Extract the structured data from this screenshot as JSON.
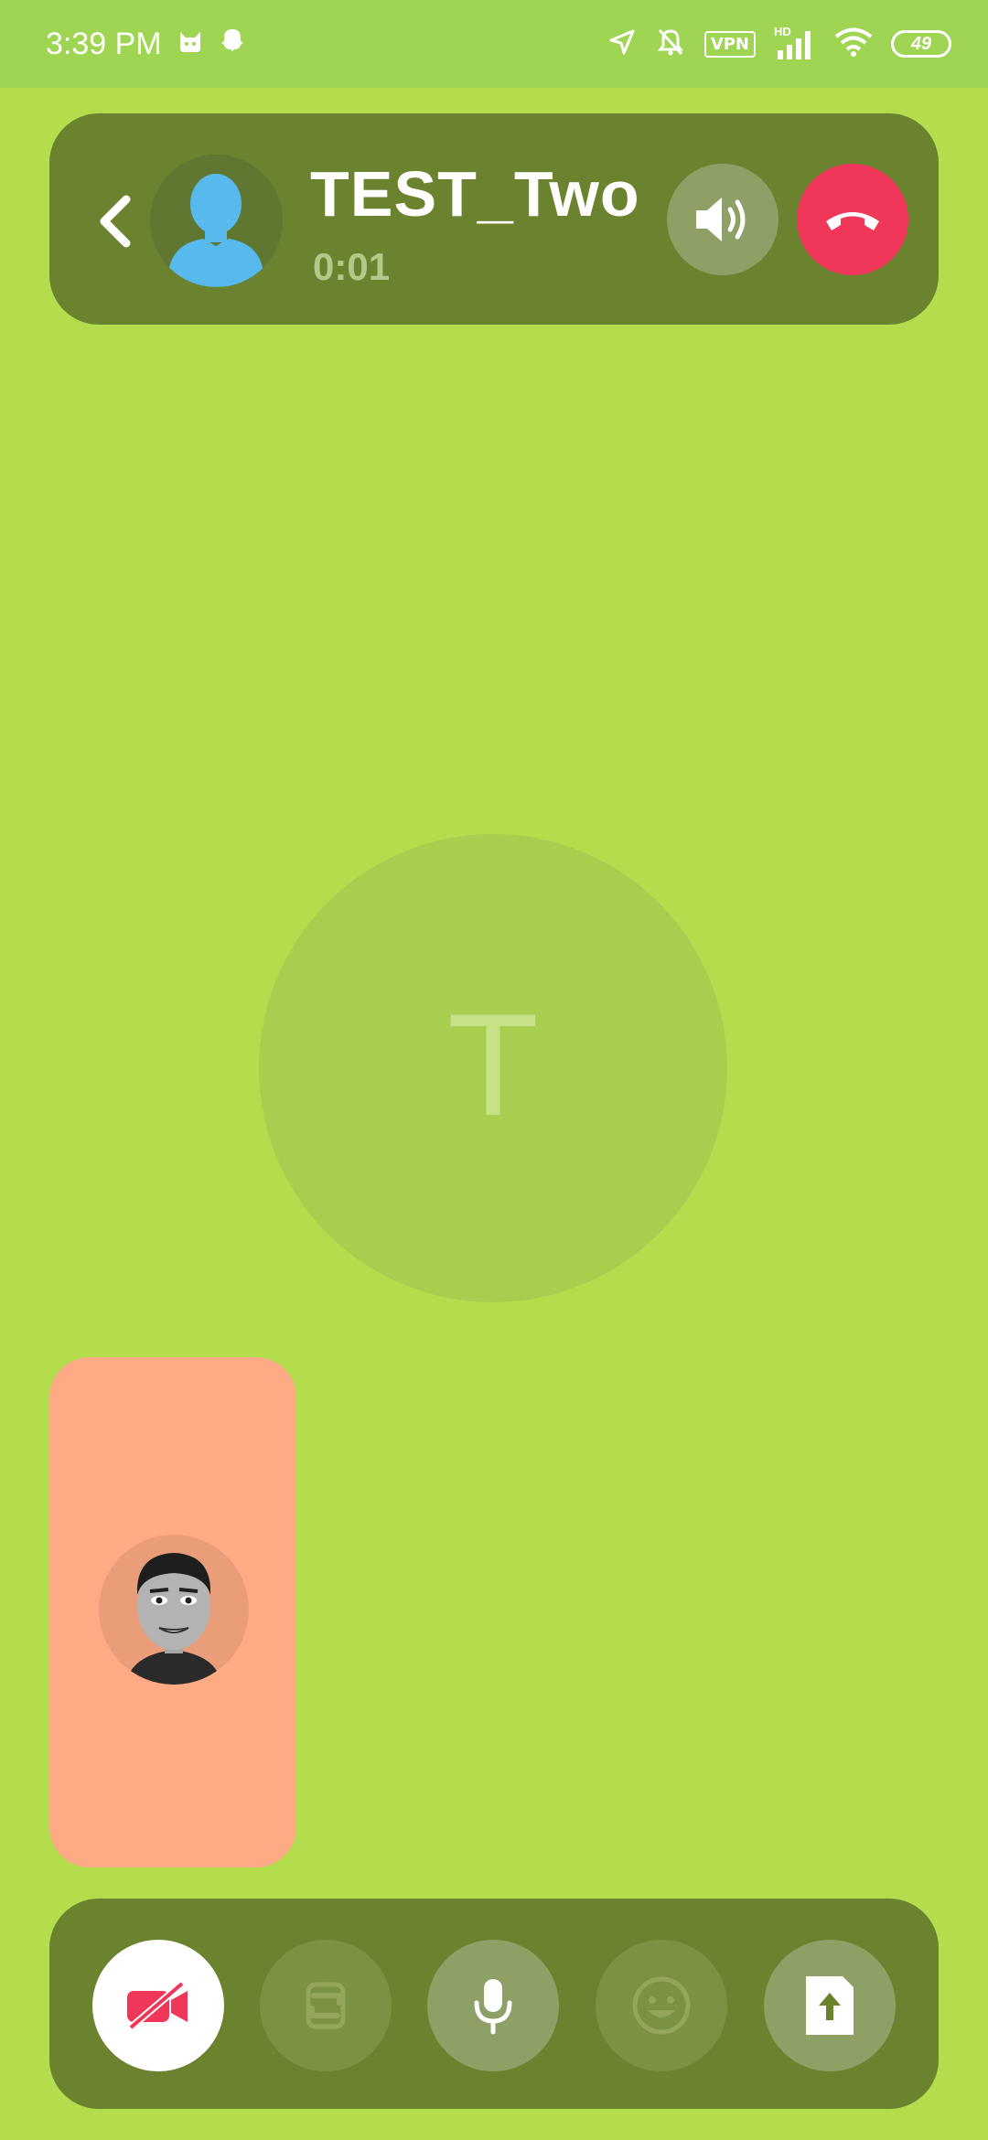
{
  "status_bar": {
    "time": "3:39 PM",
    "vpn_label": "VPN",
    "network_label": "HD",
    "battery": "49",
    "icons": [
      "cat-notification-icon",
      "snapchat-ghost-icon",
      "location-arrow-icon",
      "bell-off-icon",
      "vpn-icon",
      "signal-icon",
      "wifi-icon",
      "battery-icon"
    ]
  },
  "call": {
    "name": "TEST_Two",
    "timer": "0:01",
    "remote_initial": "T"
  },
  "colors": {
    "background": "#b3dd4c",
    "card": "#6b832f",
    "end_call": "#f0375a",
    "local_preview": "#fdab84",
    "camera_off": "#f0375a"
  },
  "controls": [
    {
      "name": "camera-toggle-button",
      "icon": "camera-off-icon",
      "state": "off"
    },
    {
      "name": "flip-camera-button",
      "icon": "flip-camera-icon",
      "state": "disabled"
    },
    {
      "name": "mute-button",
      "icon": "microphone-icon",
      "state": "on"
    },
    {
      "name": "lens-button",
      "icon": "smiley-icon",
      "state": "disabled"
    },
    {
      "name": "share-button",
      "icon": "upload-icon",
      "state": "on"
    }
  ]
}
